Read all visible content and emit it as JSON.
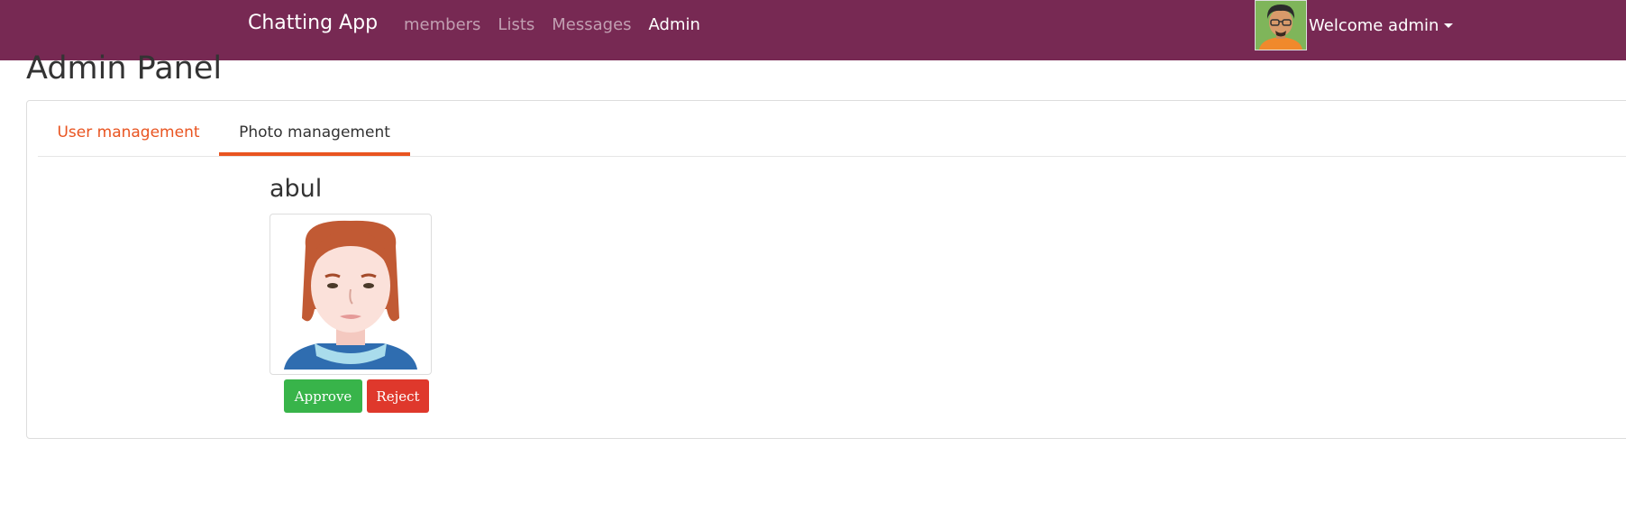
{
  "navbar": {
    "brand": "Chatting App",
    "links": [
      {
        "label": "members"
      },
      {
        "label": "Lists"
      },
      {
        "label": "Messages"
      },
      {
        "label": "Admin"
      }
    ],
    "active_link": "Admin",
    "welcome": "Welcome admin",
    "avatar_icon": "user-avatar-icon",
    "bg_color": "#772953"
  },
  "page": {
    "title": "Admin Panel"
  },
  "tabs": [
    {
      "label": "User management"
    },
    {
      "label": "Photo management"
    }
  ],
  "active_tab": "Photo management",
  "photo": {
    "username": "abul",
    "approve_label": "Approve",
    "reject_label": "Reject"
  },
  "colors": {
    "accent": "#e95420",
    "approve": "#38b44a",
    "reject": "#df382c"
  }
}
